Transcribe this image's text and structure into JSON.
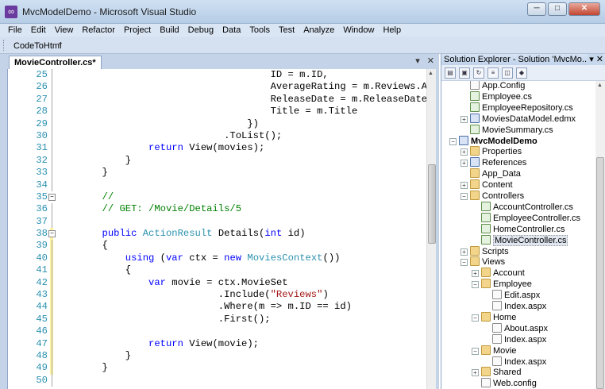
{
  "window": {
    "title": "MvcModelDemo - Microsoft Visual Studio",
    "app_icon": "vs-icon",
    "minimize": "─",
    "maximize": "□",
    "close": "✕"
  },
  "menu": [
    "File",
    "Edit",
    "View",
    "Refactor",
    "Project",
    "Build",
    "Debug",
    "Data",
    "Tools",
    "Test",
    "Analyze",
    "Window",
    "Help"
  ],
  "toolbar": {
    "button_label": "CodeToHtml",
    "dropdown_glyph": "▾"
  },
  "editor": {
    "tab_label": "MovieController.cs*",
    "pin_glyph": "▾",
    "close_glyph": "✕",
    "lines": [
      {
        "n": "25",
        "parts": [
          [
            "t",
            "                                     ID = m.ID,"
          ]
        ]
      },
      {
        "n": "26",
        "parts": [
          [
            "t",
            "                                     AverageRating = m.Reviews.Aver"
          ]
        ]
      },
      {
        "n": "27",
        "parts": [
          [
            "t",
            "                                     ReleaseDate = m.ReleaseDate,"
          ]
        ]
      },
      {
        "n": "28",
        "parts": [
          [
            "t",
            "                                     Title = m.Title"
          ]
        ]
      },
      {
        "n": "29",
        "parts": [
          [
            "t",
            "                                 })"
          ]
        ]
      },
      {
        "n": "30",
        "parts": [
          [
            "t",
            "                             .ToList();"
          ]
        ]
      },
      {
        "n": "31",
        "parts": [
          [
            "t",
            "                "
          ],
          [
            "kw",
            "return"
          ],
          [
            "t",
            " View(movies);"
          ]
        ]
      },
      {
        "n": "32",
        "parts": [
          [
            "t",
            "            }"
          ]
        ]
      },
      {
        "n": "33",
        "parts": [
          [
            "t",
            "        }"
          ]
        ]
      },
      {
        "n": "34",
        "parts": [
          [
            "t",
            ""
          ]
        ]
      },
      {
        "n": "35",
        "parts": [
          [
            "t",
            "        "
          ],
          [
            "com",
            "//"
          ]
        ],
        "fold": "−"
      },
      {
        "n": "36",
        "parts": [
          [
            "t",
            "        "
          ],
          [
            "com",
            "// GET: /Movie/Details/5"
          ]
        ]
      },
      {
        "n": "37",
        "parts": [
          [
            "t",
            ""
          ]
        ]
      },
      {
        "n": "38",
        "parts": [
          [
            "t",
            "        "
          ],
          [
            "kw",
            "public"
          ],
          [
            "t",
            " "
          ],
          [
            "type",
            "ActionResult"
          ],
          [
            "t",
            " Details("
          ],
          [
            "kw",
            "int"
          ],
          [
            "t",
            " id)"
          ]
        ],
        "fold": "−"
      },
      {
        "n": "39",
        "parts": [
          [
            "t",
            "        {"
          ]
        ]
      },
      {
        "n": "40",
        "parts": [
          [
            "t",
            "            "
          ],
          [
            "kw",
            "using"
          ],
          [
            "t",
            " ("
          ],
          [
            "kw",
            "var"
          ],
          [
            "t",
            " ctx = "
          ],
          [
            "kw",
            "new"
          ],
          [
            "t",
            " "
          ],
          [
            "type",
            "MoviesContext"
          ],
          [
            "t",
            "())"
          ]
        ]
      },
      {
        "n": "41",
        "parts": [
          [
            "t",
            "            {"
          ]
        ]
      },
      {
        "n": "42",
        "parts": [
          [
            "t",
            "                "
          ],
          [
            "kw",
            "var"
          ],
          [
            "t",
            " movie = ctx.MovieSet"
          ]
        ]
      },
      {
        "n": "43",
        "parts": [
          [
            "t",
            "                            .Include("
          ],
          [
            "str",
            "\"Reviews\""
          ],
          [
            "t",
            ")"
          ]
        ]
      },
      {
        "n": "44",
        "parts": [
          [
            "t",
            "                            .Where(m => m.ID == id)"
          ]
        ]
      },
      {
        "n": "45",
        "parts": [
          [
            "t",
            "                            .First();"
          ]
        ]
      },
      {
        "n": "46",
        "parts": [
          [
            "t",
            ""
          ]
        ]
      },
      {
        "n": "47",
        "parts": [
          [
            "t",
            "                "
          ],
          [
            "kw",
            "return"
          ],
          [
            "t",
            " View(movie);"
          ]
        ]
      },
      {
        "n": "48",
        "parts": [
          [
            "t",
            "            }"
          ]
        ]
      },
      {
        "n": "49",
        "parts": [
          [
            "t",
            "        }"
          ]
        ]
      },
      {
        "n": "50",
        "parts": [
          [
            "t",
            ""
          ]
        ]
      }
    ]
  },
  "solution_explorer": {
    "title": "Solution Explorer - Solution 'MvcMo...",
    "header_controls": "▾ ✕",
    "items": [
      {
        "label": "App.Config",
        "icon": "config-file-icon"
      },
      {
        "label": "Employee.cs",
        "icon": "cs-file-icon"
      },
      {
        "label": "EmployeeRepository.cs",
        "icon": "cs-file-icon"
      },
      {
        "label": "MoviesDataModel.edmx",
        "icon": "edmx-file-icon"
      },
      {
        "label": "MovieSummary.cs",
        "icon": "cs-file-icon"
      },
      {
        "label": "MvcModelDemo",
        "icon": "project-icon"
      },
      {
        "label": "Properties",
        "icon": "folder-icon"
      },
      {
        "label": "References",
        "icon": "references-icon"
      },
      {
        "label": "App_Data",
        "icon": "folder-icon"
      },
      {
        "label": "Content",
        "icon": "folder-icon"
      },
      {
        "label": "Controllers",
        "icon": "folder-icon"
      },
      {
        "label": "AccountController.cs",
        "icon": "cs-file-icon"
      },
      {
        "label": "EmployeeController.cs",
        "icon": "cs-file-icon"
      },
      {
        "label": "HomeController.cs",
        "icon": "cs-file-icon"
      },
      {
        "label": "MovieController.cs",
        "icon": "cs-file-icon"
      },
      {
        "label": "Scripts",
        "icon": "folder-icon"
      },
      {
        "label": "Views",
        "icon": "folder-icon"
      },
      {
        "label": "Account",
        "icon": "folder-icon"
      },
      {
        "label": "Employee",
        "icon": "folder-icon"
      },
      {
        "label": "Edit.aspx",
        "icon": "aspx-file-icon"
      },
      {
        "label": "Index.aspx",
        "icon": "aspx-file-icon"
      },
      {
        "label": "Home",
        "icon": "folder-icon"
      },
      {
        "label": "About.aspx",
        "icon": "aspx-file-icon"
      },
      {
        "label": "Index.aspx",
        "icon": "aspx-file-icon"
      },
      {
        "label": "Movie",
        "icon": "folder-icon"
      },
      {
        "label": "Index.aspx",
        "icon": "aspx-file-icon"
      },
      {
        "label": "Shared",
        "icon": "folder-icon"
      },
      {
        "label": "Web.config",
        "icon": "config-file-icon"
      }
    ]
  },
  "colors": {
    "keyword": "#0000ff",
    "type": "#2b91af",
    "string": "#a31515",
    "comment": "#008000",
    "line_number": "#2b91af"
  }
}
